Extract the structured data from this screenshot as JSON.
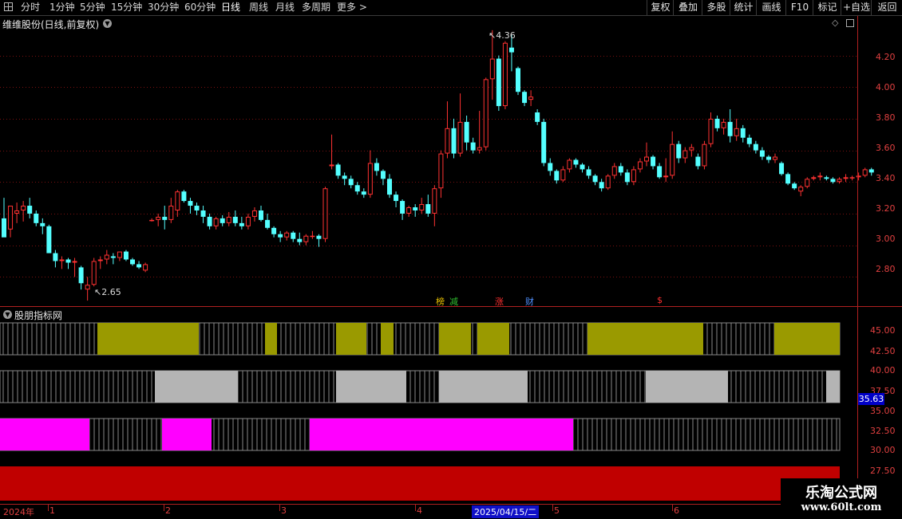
{
  "toolbar": {
    "periods": [
      "分时",
      "1分钟",
      "5分钟",
      "15分钟",
      "30分钟",
      "60分钟",
      "日线",
      "周线",
      "月线",
      "多周期",
      "更多"
    ],
    "active_period": "日线",
    "right_buttons": [
      "复权",
      "叠加",
      "多股",
      "统计",
      "画线",
      "F10",
      "标记",
      "+自选",
      "返回"
    ]
  },
  "chart_title": "维维股份(日线,前复权)",
  "indicator_title": "股朋指标网",
  "price_axis": [
    "4.20",
    "4.00",
    "3.80",
    "3.60",
    "3.40",
    "3.20",
    "3.00",
    "2.80"
  ],
  "indicator_axis": [
    "45.00",
    "42.50",
    "40.00",
    "37.50",
    "35.00",
    "32.50",
    "30.00",
    "27.50"
  ],
  "current_value": "35.63",
  "annotations": {
    "high": "4.36",
    "low": "2.65"
  },
  "event_labels": [
    {
      "text": "榜",
      "color": "#e8c000"
    },
    {
      "text": "减",
      "color": "#30c030"
    },
    {
      "text": "涨",
      "color": "#ff3030"
    },
    {
      "text": "财",
      "color": "#5090ff"
    },
    {
      "text": "$",
      "color": "#ff3030"
    }
  ],
  "date_axis": {
    "year": "2024年",
    "months": [
      "1",
      "2",
      "3",
      "4",
      "5",
      "6"
    ],
    "cursor_date": "2025/04/15/二"
  },
  "watermark": {
    "title": "乐淘公式网",
    "url": "www.60lt.com"
  },
  "colors": {
    "up": "#ff3232",
    "down": "#54ffff",
    "band1": "#9a9a00",
    "band2": "#b4b4b4",
    "band3": "#ff00ff",
    "band4": "#c00000"
  },
  "chart_data": {
    "type": "candlestick",
    "ylim": [
      2.62,
      4.45
    ],
    "candles": [
      [
        3.17,
        3.3,
        3.06,
        3.05
      ],
      [
        3.1,
        3.25,
        3.05,
        3.25
      ],
      [
        3.2,
        3.27,
        3.14,
        3.22
      ],
      [
        3.22,
        3.28,
        3.15,
        3.25
      ],
      [
        3.25,
        3.3,
        3.17,
        3.2
      ],
      [
        3.2,
        3.22,
        3.12,
        3.14
      ],
      [
        3.14,
        3.17,
        3.07,
        3.12
      ],
      [
        3.12,
        3.13,
        2.95,
        2.95
      ],
      [
        2.95,
        2.97,
        2.86,
        2.9
      ],
      [
        2.9,
        2.93,
        2.85,
        2.91
      ],
      [
        2.91,
        2.92,
        2.85,
        2.89
      ],
      [
        2.89,
        2.92,
        2.8,
        2.9
      ],
      [
        2.86,
        2.87,
        2.72,
        2.76
      ],
      [
        2.72,
        2.8,
        2.65,
        2.75
      ],
      [
        2.75,
        2.92,
        2.74,
        2.9
      ],
      [
        2.9,
        2.93,
        2.85,
        2.91
      ],
      [
        2.91,
        2.97,
        2.88,
        2.94
      ],
      [
        2.93,
        2.95,
        2.88,
        2.92
      ],
      [
        2.92,
        2.96,
        2.9,
        2.96
      ],
      [
        2.96,
        2.97,
        2.9,
        2.91
      ],
      [
        2.91,
        2.92,
        2.87,
        2.88
      ],
      [
        2.88,
        2.9,
        2.85,
        2.86
      ],
      [
        2.84,
        2.89,
        2.83,
        2.88
      ],
      [
        3.16,
        3.17,
        3.15,
        3.16
      ],
      [
        3.16,
        3.2,
        3.12,
        3.18
      ],
      [
        3.18,
        3.25,
        3.1,
        3.16
      ],
      [
        3.16,
        3.3,
        3.14,
        3.25
      ],
      [
        3.22,
        3.35,
        3.18,
        3.34
      ],
      [
        3.34,
        3.35,
        3.27,
        3.28
      ],
      [
        3.28,
        3.3,
        3.2,
        3.25
      ],
      [
        3.25,
        3.27,
        3.19,
        3.22
      ],
      [
        3.22,
        3.25,
        3.14,
        3.18
      ],
      [
        3.18,
        3.2,
        3.1,
        3.12
      ],
      [
        3.12,
        3.18,
        3.1,
        3.17
      ],
      [
        3.17,
        3.19,
        3.12,
        3.14
      ],
      [
        3.14,
        3.21,
        3.12,
        3.18
      ],
      [
        3.18,
        3.22,
        3.12,
        3.14
      ],
      [
        3.14,
        3.18,
        3.1,
        3.12
      ],
      [
        3.12,
        3.2,
        3.1,
        3.18
      ],
      [
        3.18,
        3.24,
        3.15,
        3.22
      ],
      [
        3.22,
        3.25,
        3.15,
        3.16
      ],
      [
        3.16,
        3.2,
        3.1,
        3.11
      ],
      [
        3.11,
        3.12,
        3.05,
        3.07
      ],
      [
        3.07,
        3.09,
        3.02,
        3.05
      ],
      [
        3.05,
        3.09,
        3.03,
        3.08
      ],
      [
        3.08,
        3.09,
        3.02,
        3.04
      ],
      [
        3.04,
        3.08,
        3.0,
        3.02
      ],
      [
        3.02,
        3.07,
        3.0,
        3.06
      ],
      [
        3.06,
        3.09,
        3.04,
        3.06
      ],
      [
        3.06,
        3.07,
        2.99,
        3.04
      ],
      [
        3.04,
        3.37,
        3.02,
        3.36
      ],
      [
        3.5,
        3.7,
        3.48,
        3.51
      ],
      [
        3.51,
        3.52,
        3.42,
        3.44
      ],
      [
        3.44,
        3.46,
        3.38,
        3.42
      ],
      [
        3.42,
        3.44,
        3.36,
        3.38
      ],
      [
        3.38,
        3.4,
        3.32,
        3.34
      ],
      [
        3.34,
        3.36,
        3.3,
        3.32
      ],
      [
        3.32,
        3.6,
        3.3,
        3.52
      ],
      [
        3.52,
        3.55,
        3.44,
        3.47
      ],
      [
        3.47,
        3.48,
        3.38,
        3.42
      ],
      [
        3.42,
        3.45,
        3.3,
        3.32
      ],
      [
        3.32,
        3.34,
        3.24,
        3.28
      ],
      [
        3.28,
        3.29,
        3.16,
        3.2
      ],
      [
        3.2,
        3.25,
        3.18,
        3.24
      ],
      [
        3.24,
        3.26,
        3.18,
        3.22
      ],
      [
        3.22,
        3.3,
        3.2,
        3.26
      ],
      [
        3.26,
        3.32,
        3.18,
        3.2
      ],
      [
        3.2,
        3.38,
        3.12,
        3.36
      ],
      [
        3.36,
        3.6,
        3.3,
        3.58
      ],
      [
        3.58,
        3.91,
        3.55,
        3.74
      ],
      [
        3.74,
        3.8,
        3.55,
        3.58
      ],
      [
        3.58,
        3.96,
        3.56,
        3.78
      ],
      [
        3.78,
        3.82,
        3.6,
        3.65
      ],
      [
        3.65,
        3.68,
        3.58,
        3.6
      ],
      [
        3.6,
        3.85,
        3.58,
        3.62
      ],
      [
        3.62,
        4.06,
        3.6,
        4.05
      ],
      [
        4.05,
        4.36,
        3.92,
        4.18
      ],
      [
        4.18,
        4.2,
        3.85,
        3.88
      ],
      [
        3.88,
        4.29,
        3.86,
        4.28
      ],
      [
        4.25,
        4.33,
        4.1,
        4.22
      ],
      [
        4.12,
        4.13,
        3.95,
        3.97
      ],
      [
        3.97,
        3.98,
        3.88,
        3.9
      ],
      [
        3.92,
        3.98,
        3.88,
        3.94
      ],
      [
        3.84,
        3.86,
        3.76,
        3.78
      ],
      [
        3.78,
        3.8,
        3.5,
        3.52
      ],
      [
        3.52,
        3.55,
        3.44,
        3.47
      ],
      [
        3.47,
        3.48,
        3.39,
        3.41
      ],
      [
        3.41,
        3.5,
        3.4,
        3.48
      ],
      [
        3.48,
        3.55,
        3.46,
        3.54
      ],
      [
        3.54,
        3.55,
        3.49,
        3.51
      ],
      [
        3.51,
        3.52,
        3.46,
        3.48
      ],
      [
        3.48,
        3.5,
        3.42,
        3.44
      ],
      [
        3.44,
        3.45,
        3.38,
        3.4
      ],
      [
        3.4,
        3.42,
        3.34,
        3.36
      ],
      [
        3.36,
        3.45,
        3.35,
        3.44
      ],
      [
        3.44,
        3.52,
        3.42,
        3.5
      ],
      [
        3.5,
        3.52,
        3.44,
        3.46
      ],
      [
        3.46,
        3.48,
        3.38,
        3.4
      ],
      [
        3.4,
        3.5,
        3.38,
        3.48
      ],
      [
        3.48,
        3.55,
        3.46,
        3.53
      ],
      [
        3.53,
        3.65,
        3.5,
        3.56
      ],
      [
        3.56,
        3.57,
        3.48,
        3.5
      ],
      [
        3.5,
        3.52,
        3.42,
        3.43
      ],
      [
        3.43,
        3.55,
        3.4,
        3.44
      ],
      [
        3.44,
        3.72,
        3.42,
        3.64
      ],
      [
        3.64,
        3.66,
        3.52,
        3.55
      ],
      [
        3.55,
        3.62,
        3.52,
        3.6
      ],
      [
        3.6,
        3.64,
        3.56,
        3.62
      ],
      [
        3.56,
        3.58,
        3.48,
        3.5
      ],
      [
        3.5,
        3.66,
        3.48,
        3.64
      ],
      [
        3.64,
        3.84,
        3.62,
        3.8
      ],
      [
        3.8,
        3.82,
        3.72,
        3.74
      ],
      [
        3.74,
        3.8,
        3.7,
        3.78
      ],
      [
        3.78,
        3.86,
        3.65,
        3.69
      ],
      [
        3.69,
        3.8,
        3.66,
        3.74
      ],
      [
        3.74,
        3.76,
        3.65,
        3.68
      ],
      [
        3.68,
        3.7,
        3.62,
        3.64
      ],
      [
        3.64,
        3.66,
        3.58,
        3.6
      ],
      [
        3.6,
        3.62,
        3.54,
        3.56
      ],
      [
        3.56,
        3.57,
        3.52,
        3.54
      ],
      [
        3.54,
        3.58,
        3.52,
        3.56
      ],
      [
        3.52,
        3.53,
        3.44,
        3.45
      ],
      [
        3.45,
        3.46,
        3.38,
        3.39
      ],
      [
        3.39,
        3.4,
        3.35,
        3.36
      ],
      [
        3.34,
        3.38,
        3.31,
        3.37
      ],
      [
        3.37,
        3.43,
        3.36,
        3.42
      ],
      [
        3.42,
        3.44,
        3.41,
        3.43
      ],
      [
        3.43,
        3.46,
        3.41,
        3.44
      ],
      [
        3.43,
        3.44,
        3.41,
        3.42
      ],
      [
        3.42,
        3.43,
        3.39,
        3.4
      ],
      [
        3.4,
        3.43,
        3.39,
        3.42
      ],
      [
        3.42,
        3.45,
        3.4,
        3.43
      ],
      [
        3.43,
        3.44,
        3.41,
        3.43
      ],
      [
        3.43,
        3.46,
        3.41,
        3.44
      ],
      [
        3.44,
        3.49,
        3.43,
        3.48
      ],
      [
        3.48,
        3.49,
        3.44,
        3.46
      ]
    ]
  }
}
